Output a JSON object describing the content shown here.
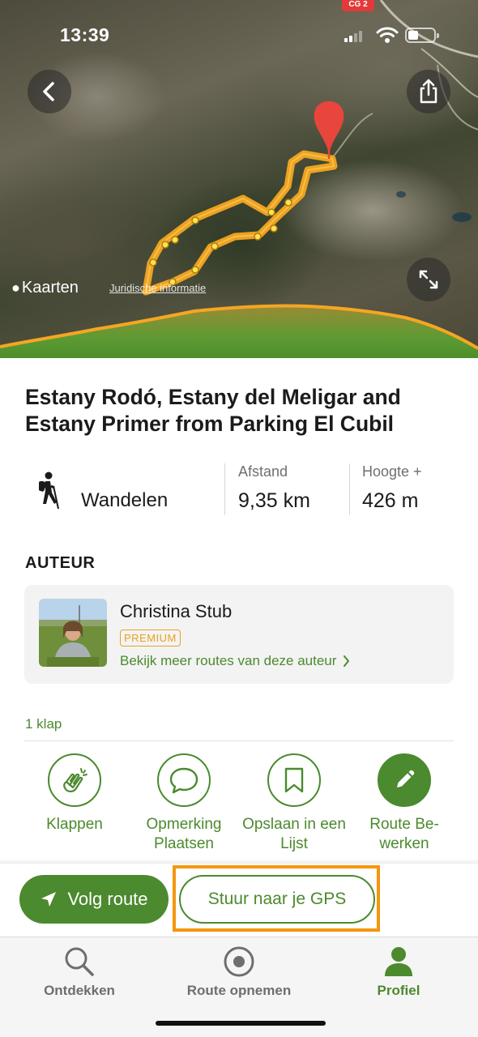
{
  "status_bar": {
    "time": "13:39",
    "badge": "CG 2",
    "icons": [
      "cellular-signal-icon",
      "wifi-icon",
      "battery-icon"
    ]
  },
  "map": {
    "attribution_brand": "Kaarten",
    "attribution_legal": "Juridische informatie",
    "buttons": [
      "back-icon",
      "share-icon",
      "expand-icon"
    ],
    "route_color": "#f5a623",
    "marker_color": "#e8453c"
  },
  "route": {
    "title": "Estany Rodó, Estany del Meligar and Estany Primer from Parking El Cubil",
    "activity": "Wandelen",
    "distance_label": "Afstand",
    "distance_value": "9,35 km",
    "elevation_label": "Hoogte +",
    "elevation_value": "426 m"
  },
  "author": {
    "section_title": "AUTEUR",
    "name": "Christina Stub",
    "badge": "PREMIUM",
    "link": "Bekijk meer routes van deze auteur"
  },
  "engagement": {
    "count": "1 klap"
  },
  "actions": [
    {
      "label": "Klappen",
      "icon": "clap-icon"
    },
    {
      "label": "Opmerking Plaatsen",
      "icon": "comment-icon"
    },
    {
      "label": "Opslaan in een Lijst",
      "icon": "bookmark-icon"
    },
    {
      "label": "Route Be-werken",
      "icon": "pencil-icon"
    }
  ],
  "cta": {
    "follow": "Volg route",
    "send_gps": "Stuur naar je GPS",
    "highlight_color": "#f5960f"
  },
  "tabs": [
    {
      "label": "Ontdekken",
      "icon": "search-icon",
      "active": false
    },
    {
      "label": "Route opnemen",
      "icon": "record-icon",
      "active": false
    },
    {
      "label": "Profiel",
      "icon": "profile-icon",
      "active": true
    }
  ],
  "colors": {
    "accent": "#4b8a2e",
    "premium": "#e6a31e"
  }
}
